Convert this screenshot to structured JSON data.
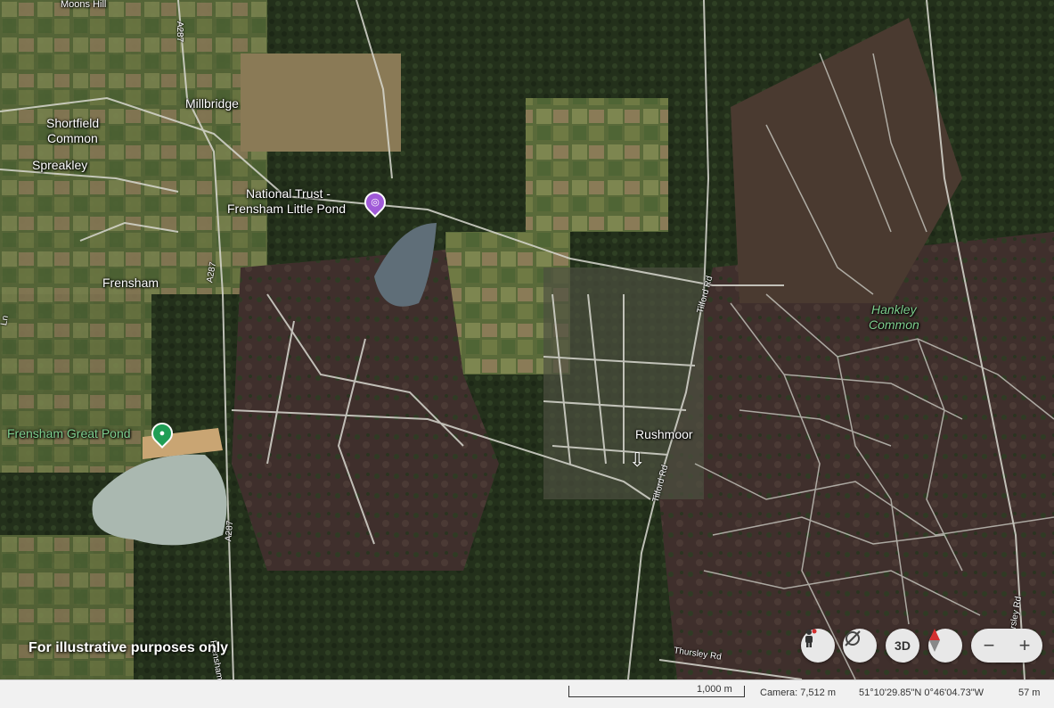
{
  "map": {
    "place_labels": [
      "Moons Hill",
      "Millbridge",
      "Shortfield",
      "Common",
      "Spreakley",
      "Frensham",
      "Rushmoor"
    ],
    "poi_labels": [
      "National Trust -",
      "Frensham Little Pond",
      "Frensham Great Pond"
    ],
    "nature_labels": [
      "Hankley",
      "Common"
    ],
    "road_labels": [
      "A287",
      "A287",
      "A287",
      "Tilford Rd",
      "Tilford Rd",
      "Thursley Rd",
      "Thursley Rd",
      "Frensham",
      "Ln"
    ],
    "disclaimer": "For illustrative purposes only",
    "icons": {
      "poi_little_pond": "camera-icon",
      "poi_great_pond": "pin-icon",
      "cursor": "hand-cursor-icon"
    },
    "colors": {
      "poi_purple": "#a05ad8",
      "poi_green": "#1f9e55"
    }
  },
  "controls": {
    "pegman": "person-icon",
    "reset_north": "compass-reset-icon",
    "view_3d": "3D",
    "compass": "compass-icon",
    "zoom_out": "−",
    "zoom_in": "+"
  },
  "status": {
    "scale": "1,000 m",
    "camera": "Camera: 7,512 m",
    "coordinates": "51°10'29.85\"N 0°46'04.73\"W",
    "elevation": "57 m"
  }
}
